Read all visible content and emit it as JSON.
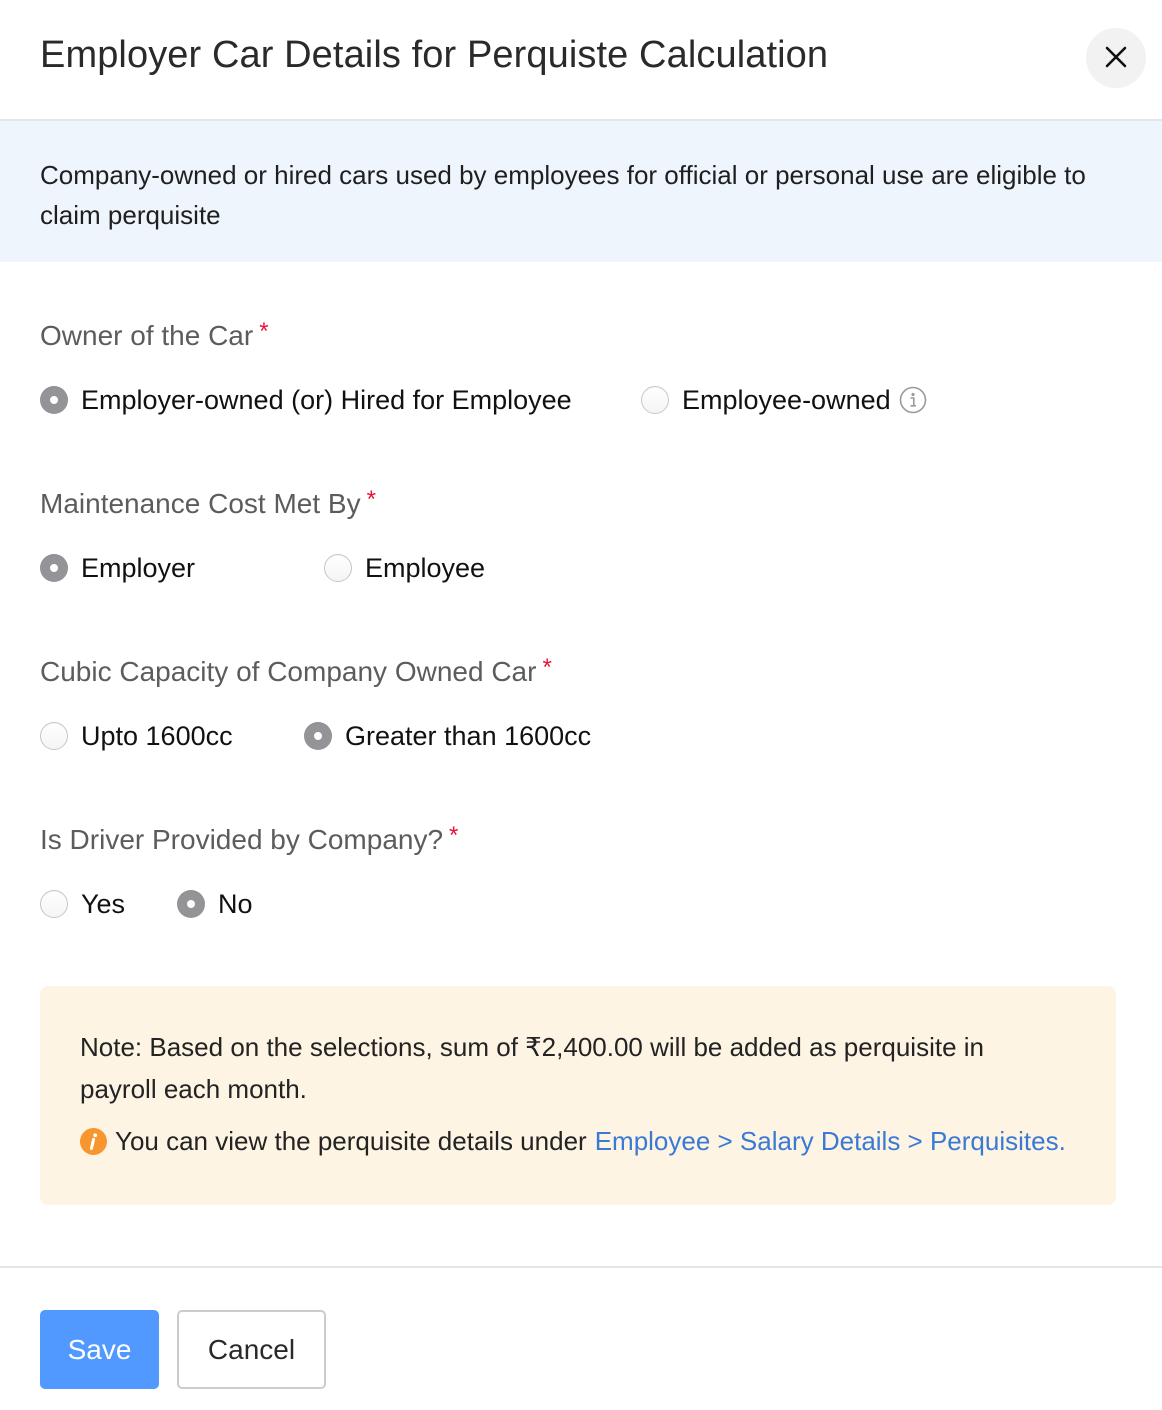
{
  "header": {
    "title": "Employer Car Details for Perquiste Calculation",
    "close_icon": "close-icon"
  },
  "banner": {
    "text": "Company-owned or hired cars used by employees for official or personal use are eligible to claim perquisite"
  },
  "form": {
    "required_marker": "*",
    "owner": {
      "label": "Owner of the Car",
      "options": [
        {
          "label": "Employer-owned (or) Hired for Employee",
          "checked": true
        },
        {
          "label": "Employee-owned",
          "checked": false,
          "icon": "info-icon"
        }
      ]
    },
    "maintenance": {
      "label": "Maintenance Cost Met By",
      "options": [
        {
          "label": "Employer",
          "checked": true
        },
        {
          "label": "Employee",
          "checked": false
        }
      ]
    },
    "cubic_capacity": {
      "label": "Cubic Capacity of Company Owned Car",
      "options": [
        {
          "label": "Upto 1600cc",
          "checked": false
        },
        {
          "label": "Greater than 1600cc",
          "checked": true
        }
      ]
    },
    "driver": {
      "label": "Is Driver Provided by Company?",
      "options": [
        {
          "label": "Yes",
          "checked": false
        },
        {
          "label": "No",
          "checked": true
        }
      ]
    }
  },
  "note": {
    "text": "Note: Based on the selections, sum of ₹2,400.00 will be added as perquisite in payroll each month.",
    "hint_prefix": "You can view the perquisite details under",
    "hint_link": "Employee > Salary Details > Perquisites.",
    "hint_icon": "info-circle-orange-icon"
  },
  "footer": {
    "save_label": "Save",
    "cancel_label": "Cancel"
  },
  "colors": {
    "primary": "#5199ff",
    "required": "#e8143b",
    "link": "#3a7ad6",
    "banner_bg": "#eef5fd",
    "note_bg": "#fdf4e3",
    "note_icon": "#f7952f",
    "radio_checked": "#939398"
  }
}
